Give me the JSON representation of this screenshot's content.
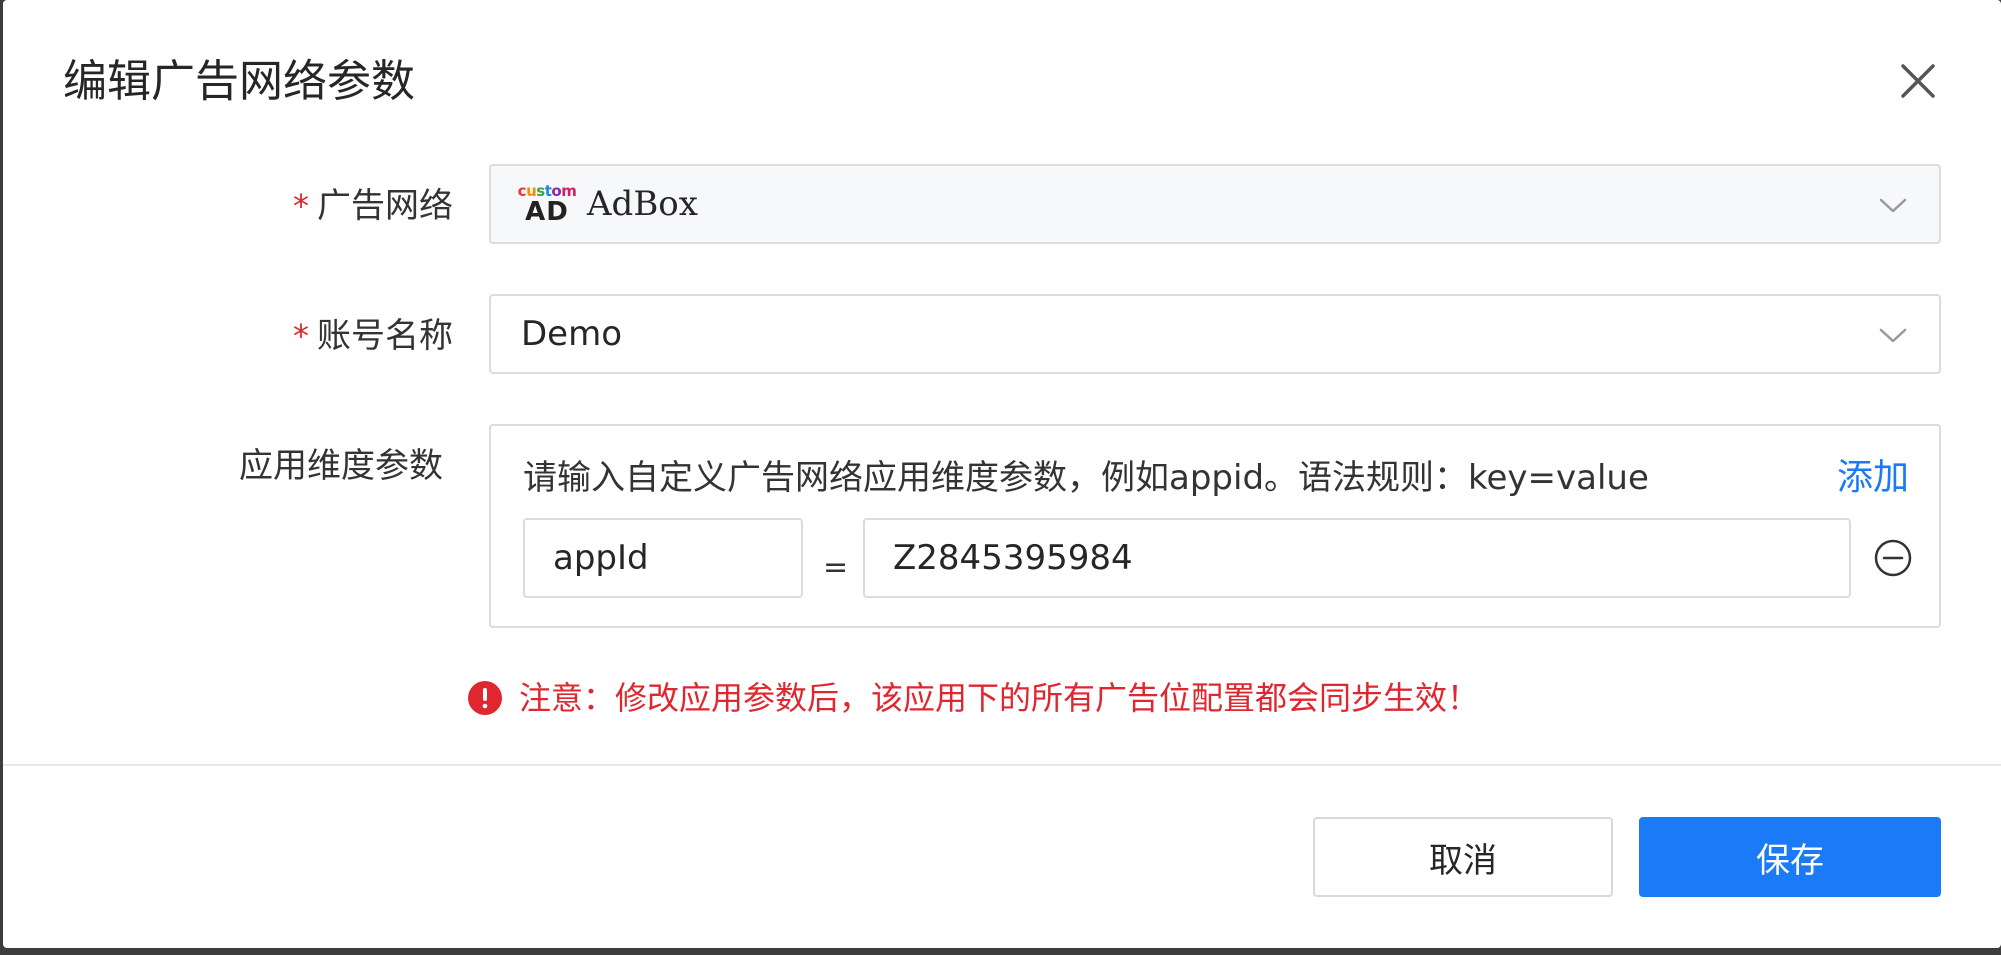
{
  "dialog": {
    "title": "编辑广告网络参数",
    "close_icon": "close-icon"
  },
  "form": {
    "required_mark": "*",
    "ad_network": {
      "label": "广告网络",
      "logo_top": [
        "c",
        "u",
        "s",
        "t",
        "o",
        "m"
      ],
      "logo_bottom": "AD",
      "value": "AdBox",
      "icon": "chevron-down-icon"
    },
    "account": {
      "label": "账号名称",
      "value": "Demo",
      "icon": "chevron-down-icon"
    },
    "app_params": {
      "label": "应用维度参数",
      "hint": "请输入自定义广告网络应用维度参数，例如appid。语法规则：key=value",
      "add_label": "添加",
      "rows": [
        {
          "key": "appId",
          "separator": "=",
          "value": "Z2845395984"
        }
      ],
      "remove_icon": "minus-circle-icon"
    },
    "notice": {
      "icon": "exclamation-circle-icon",
      "text": "注意：修改应用参数后，该应用下的所有广告位配置都会同步生效！"
    }
  },
  "footer": {
    "cancel_label": "取消",
    "save_label": "保存"
  },
  "colors": {
    "primary": "#1a7af8",
    "danger": "#e0262e",
    "border": "#dcdcdc"
  }
}
